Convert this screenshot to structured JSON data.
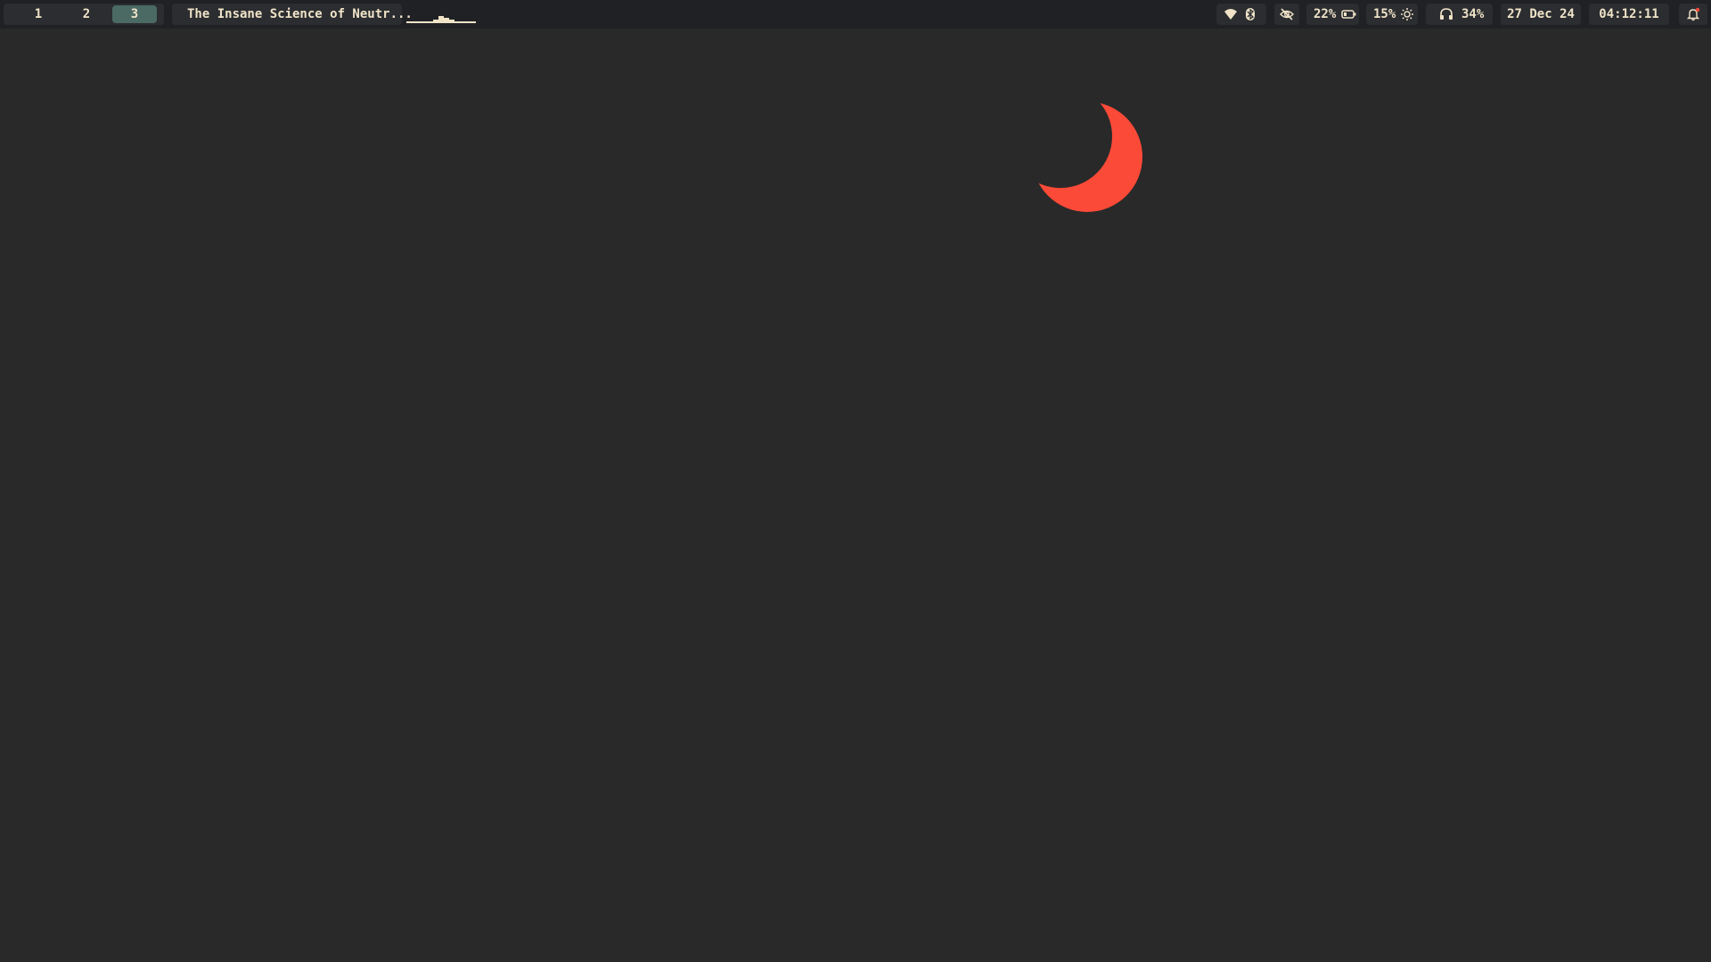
{
  "topbar": {
    "workspaces": [
      "1",
      "2",
      "3"
    ],
    "active_workspace": "3",
    "window_title": "The Insane Science of Neutr...",
    "audio_visualizer": [
      1,
      1,
      1,
      1,
      1,
      2,
      4,
      3,
      2,
      1,
      1,
      1,
      1
    ],
    "wifi_icon": "wifi-icon",
    "bluetooth_icon": "bluetooth-icon",
    "privacy_icon": "eye-off-icon",
    "battery": "22%",
    "battery_icon": "battery-icon",
    "brightness": "15%",
    "brightness_icon": "brightness-icon",
    "headphones_icon": "headphones-icon",
    "volume": "34%",
    "date": "27 Dec 24",
    "time": "04:12:11",
    "notification_icon": "bell-icon"
  },
  "wallpaper": {
    "moon_icon": "crescent-moon-icon",
    "moon_color": "#fc4a38",
    "background_color": "#292929"
  }
}
